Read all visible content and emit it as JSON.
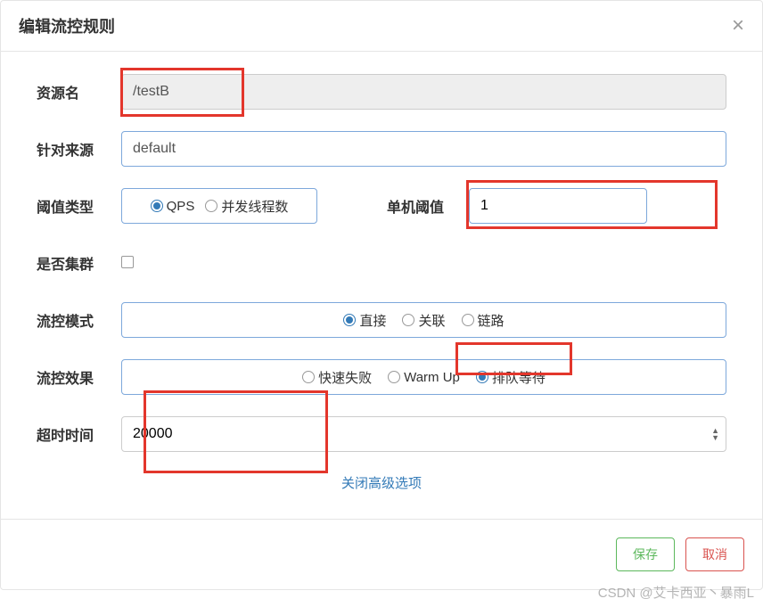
{
  "modal": {
    "title": "编辑流控规则"
  },
  "form": {
    "resource": {
      "label": "资源名",
      "value": "/testB"
    },
    "origin": {
      "label": "针对来源",
      "value": "default"
    },
    "thresholdType": {
      "label": "阈值类型",
      "options": {
        "qps": "QPS",
        "thread": "并发线程数"
      },
      "selected": "qps"
    },
    "thresholdValue": {
      "label": "单机阈值",
      "value": "1"
    },
    "cluster": {
      "label": "是否集群",
      "checked": false
    },
    "mode": {
      "label": "流控模式",
      "options": {
        "direct": "直接",
        "relate": "关联",
        "chain": "链路"
      },
      "selected": "direct"
    },
    "effect": {
      "label": "流控效果",
      "options": {
        "fail": "快速失败",
        "warmup": "Warm Up",
        "queue": "排队等待"
      },
      "selected": "queue"
    },
    "timeout": {
      "label": "超时时间",
      "value": "20000"
    },
    "closeAdvanced": "关闭高级选项"
  },
  "buttons": {
    "save": "保存",
    "cancel": "取消"
  },
  "watermark": "CSDN @艾卡西亚丶暴雨L"
}
